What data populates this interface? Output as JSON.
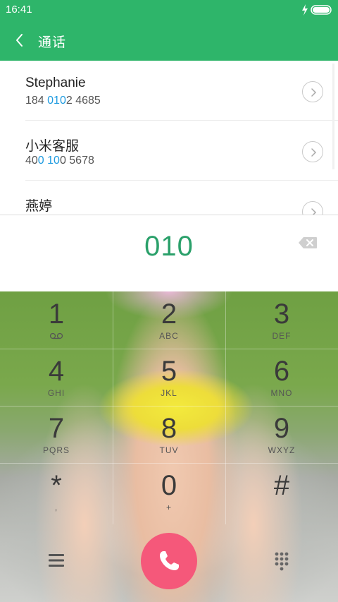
{
  "status_bar": {
    "time": "16:41",
    "charging_icon": "bolt-icon",
    "battery_icon": "battery-icon"
  },
  "header": {
    "title": "通话",
    "back_icon": "chevron-left-icon",
    "color": "#2eb56a"
  },
  "contacts": [
    {
      "name": "Stephanie",
      "number_parts": [
        {
          "text": "184 ",
          "hl": false
        },
        {
          "text": "010",
          "hl": true
        },
        {
          "text": "2 4685",
          "hl": false
        }
      ]
    },
    {
      "name": "小米客服",
      "number_parts": [
        {
          "text": "40",
          "hl": false
        },
        {
          "text": "0 10",
          "hl": true
        },
        {
          "text": "0 5678",
          "hl": false
        }
      ]
    },
    {
      "name": "燕婷",
      "number_parts": []
    }
  ],
  "dialed_number": "010",
  "keypad": [
    {
      "digit": "1",
      "letters": ""
    },
    {
      "digit": "2",
      "letters": "ABC"
    },
    {
      "digit": "3",
      "letters": "DEF"
    },
    {
      "digit": "4",
      "letters": "GHI"
    },
    {
      "digit": "5",
      "letters": "JKL"
    },
    {
      "digit": "6",
      "letters": "MNO"
    },
    {
      "digit": "7",
      "letters": "PQRS"
    },
    {
      "digit": "8",
      "letters": "TUV"
    },
    {
      "digit": "9",
      "letters": "WXYZ"
    },
    {
      "digit": "*",
      "letters": ","
    },
    {
      "digit": "0",
      "letters": "+"
    },
    {
      "digit": "#",
      "letters": ""
    }
  ],
  "bottom_bar": {
    "menu_icon": "menu-icon",
    "call_icon": "phone-icon",
    "dialpad_icon": "dialpad-icon"
  },
  "colors": {
    "accent": "#2eb56a",
    "highlight": "#1e9be0",
    "dialed": "#2aa06a",
    "call": "#f5587a"
  }
}
